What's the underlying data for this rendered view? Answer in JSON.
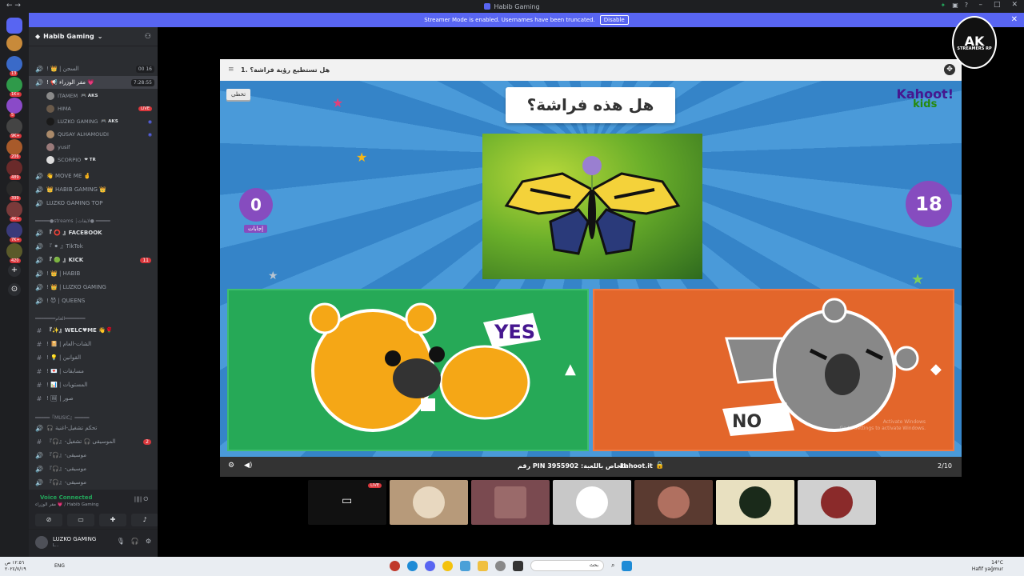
{
  "window": {
    "title": "Habib Gaming"
  },
  "banner": {
    "text": "Streamer Mode is enabled. Usernames have been truncated.",
    "disable_label": "Disable"
  },
  "server": {
    "name": "Habib Gaming"
  },
  "channels": [
    {
      "type": "voice",
      "name": "! 👑 | السجن",
      "count": "00 16"
    },
    {
      "type": "voice",
      "name": "! 📢 مقر الوزراء 💗",
      "count": "7:28:55",
      "active": true
    },
    {
      "type": "voice",
      "name": "👋 MOVE ME 🤞"
    },
    {
      "type": "voice",
      "name": "👑 HABIB GAMING 👑"
    },
    {
      "type": "voice",
      "name": "LUZKO GAMING TOP"
    },
    {
      "type": "category",
      "name": "━━━━━●streams ┊لايفات● ━━━━━"
    },
    {
      "type": "voice",
      "name": "『 ⭕ 』FACEBOOK",
      "bright": true
    },
    {
      "type": "voice",
      "name": "『 ⚫ 』TikTok"
    },
    {
      "type": "voice",
      "name": "『 🟢 』KICK",
      "bright": true,
      "badge": "11"
    },
    {
      "type": "voice",
      "name": "! 👑 | HABIB"
    },
    {
      "type": "voice",
      "name": "! 👑 | LUZKO GAMING"
    },
    {
      "type": "voice",
      "name": "! 😈 | QUEENS"
    },
    {
      "type": "category",
      "name": "━━━━━━━العام━━━━━━━"
    },
    {
      "type": "text",
      "name": "『✨』WELC♥ME 👋🌹"
    },
    {
      "type": "text",
      "name": "! 📔 | الشات-العام"
    },
    {
      "type": "text",
      "name": "! 💡 | القوانين"
    },
    {
      "type": "text",
      "name": "! 💌 | مسابقات"
    },
    {
      "type": "text",
      "name": "! 📊 | المستويات"
    },
    {
      "type": "text",
      "name": "! 🖼 | صور"
    },
    {
      "type": "category",
      "name": "━━━━━『MUSIC』━━━━━"
    },
    {
      "type": "voice",
      "name": "🎧 تحكم تشغيل-اغنية"
    },
    {
      "type": "text",
      "name": "『🎧』-الموسيقى 🎧 تشغيل",
      "badge": "2"
    },
    {
      "type": "voice",
      "name": "『🎧』-موسيقى"
    },
    {
      "type": "voice",
      "name": "『🎧』-موسيقى"
    },
    {
      "type": "voice",
      "name": "『🎧』-موسيقى"
    }
  ],
  "members": [
    {
      "name": "ITAMEM",
      "tag": "🎮 AKS"
    },
    {
      "name": "HIMA",
      "live": "LIVE"
    },
    {
      "name": "LUZKO GAMING",
      "tag": "🎮 AKS"
    },
    {
      "name": "QUSAY ALHAMOUDI"
    },
    {
      "name": "yusif"
    },
    {
      "name": "SCORPIO",
      "tag": "❤ TR"
    }
  ],
  "voice": {
    "status": "Voice Connected",
    "sub": "مقر الوزراء 💗 / Habib Gaming"
  },
  "user": {
    "name": "LUZKO GAMING",
    "status": "L..."
  },
  "shared_window": {
    "title": "1. هل تستطيع رؤية فراشة؟",
    "skip_label": "تخطى",
    "question": "هل هذه فراشة؟",
    "logo_text": "Kahoot!",
    "logo_sub": "kids",
    "answers_count": "0",
    "answers_label": "إجابات",
    "timer": "18",
    "answer_yes": "YES",
    "answer_no": "NO",
    "watermark_line1": "Activate Windows",
    "watermark_line2": "Go to Settings to activate Windows.",
    "pin_text": "رقم PIN الخاص باللعبة: 3955902",
    "site": "kahoot.it",
    "progress": "2/10"
  },
  "stream_tiles": [
    {
      "kind": "screen",
      "live": "LIVE"
    },
    {
      "kind": "avatar",
      "color": "#b79a7a"
    },
    {
      "kind": "avatar",
      "color": "#7a4a50"
    },
    {
      "kind": "avatar",
      "color": "#c8c8c8"
    },
    {
      "kind": "avatar",
      "color": "#5a3a30"
    },
    {
      "kind": "avatar",
      "color": "#e8e0c0"
    },
    {
      "kind": "avatar",
      "color": "#d0d0d0"
    }
  ],
  "corner_logo": {
    "text": "AK",
    "sub": "STREAMERS RP"
  },
  "taskbar": {
    "time": "١٢:٥٦ ص",
    "date": "٢٠٢٤/٧/١٩",
    "lang": "ENG",
    "search_placeholder": "بحث",
    "weather_temp": "14°C",
    "weather_desc": "Hafif yağmur"
  }
}
